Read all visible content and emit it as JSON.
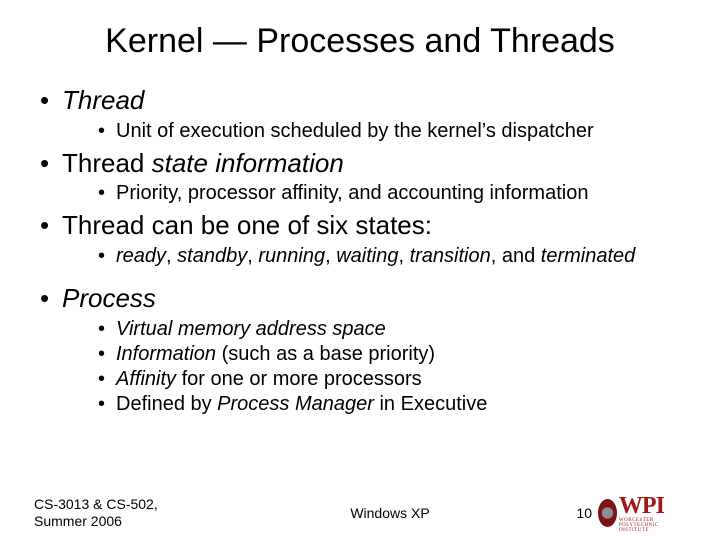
{
  "title": "Kernel — Processes and Threads",
  "b1": {
    "head_it": "Thread",
    "sub": "Unit of execution scheduled by the kernel’s dispatcher"
  },
  "b2": {
    "head_a": "Thread ",
    "head_it": "state information",
    "sub": "Priority, processor affinity, and accounting information"
  },
  "b3": {
    "head": "Thread can be one of six states:",
    "s_it_a": "ready",
    "s_c1": ", ",
    "s_it_b": "standby",
    "s_c2": ", ",
    "s_it_c": "running",
    "s_c3": ", ",
    "s_it_d": "waiting",
    "s_c4": ", ",
    "s_it_e": "transition",
    "s_c5": ", and ",
    "s_it_f": "terminated"
  },
  "b4": {
    "head_it": "Process",
    "s1_it": "Virtual memory address space",
    "s2_it": "Information",
    "s2_rest": " (such as a base priority)",
    "s3_it": "Affinity",
    "s3_rest": " for one or more processors",
    "s4_a": "Defined by ",
    "s4_it": "Process Manager",
    "s4_b": " in Executive"
  },
  "footer": {
    "left_l1": "CS-3013 & CS-502,",
    "left_l2": "Summer 2006",
    "mid": "Windows XP",
    "page": "10",
    "logo_text": "WPI",
    "logo_sub": "WORCESTER POLYTECHNIC INSTITUTE"
  }
}
